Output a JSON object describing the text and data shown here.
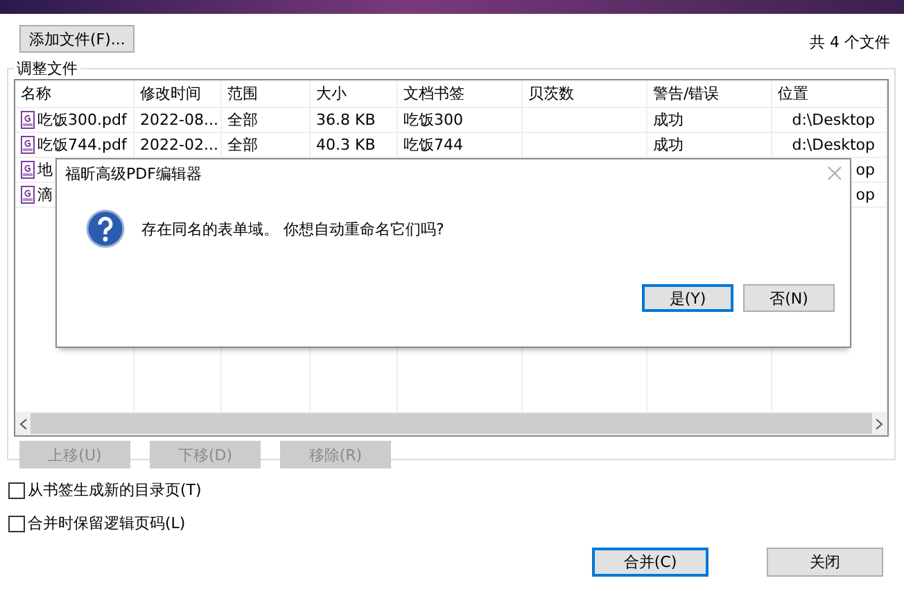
{
  "add_file_button": "添加文件(F)...",
  "file_count": "共 4 个文件",
  "group_title": "调整文件",
  "table": {
    "columns": [
      "名称",
      "修改时间",
      "范围",
      "大小",
      "文档书签",
      "贝茨数",
      "警告/错误",
      "位置"
    ],
    "rows": [
      {
        "name": "吃饭300.pdf",
        "modified": "2022-08...",
        "range": "全部",
        "size": "36.8 KB",
        "bookmark": "吃饭300",
        "status": "成功",
        "location": "d:\\Desktop"
      },
      {
        "name": "吃饭744.pdf",
        "modified": "2022-02...",
        "range": "全部",
        "size": "40.3 KB",
        "bookmark": "吃饭744",
        "status": "成功",
        "location": "d:\\Desktop"
      },
      {
        "name": "地",
        "location": "op"
      },
      {
        "name": "滴",
        "location": "op"
      }
    ]
  },
  "move_buttons": [
    {
      "label": "上移(U)",
      "disabled": true
    },
    {
      "label": "下移(D)",
      "disabled": true
    },
    {
      "label": "移除(R)",
      "disabled": true
    }
  ],
  "options": [
    {
      "label": "从书签生成新的目录页(T)",
      "checked": false
    },
    {
      "label": "合并时保留逻辑页码(L)",
      "checked": false
    }
  ],
  "buttons": [
    {
      "label": "合并(C)",
      "default": true
    },
    {
      "label": "关闭",
      "default": false
    }
  ],
  "dialog": {
    "title": "福昕高级PDF编辑器",
    "message": "存在同名的表单域。 你想自动重命名它们吗?",
    "buttons": [
      {
        "label": "是(Y)",
        "default": true
      },
      {
        "label": "否(N)",
        "default": false
      }
    ]
  }
}
